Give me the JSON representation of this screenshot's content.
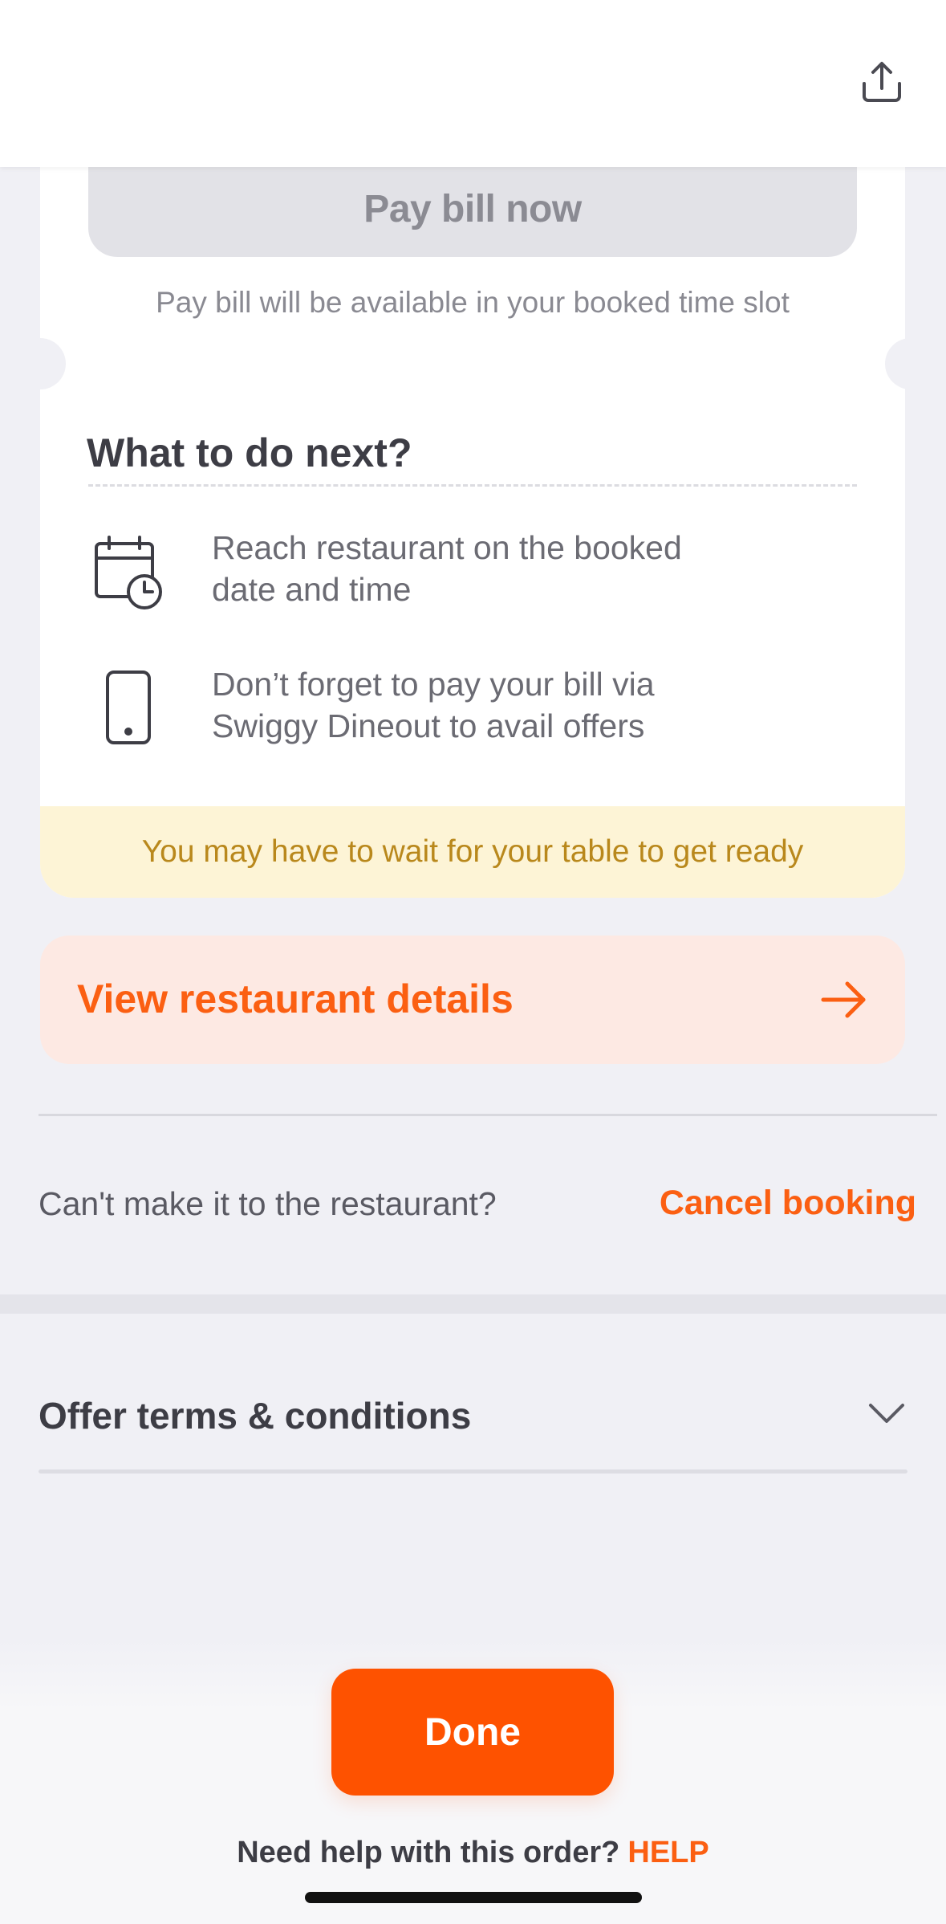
{
  "header": {
    "share_icon": "share-upload-icon"
  },
  "booking_card": {
    "pay_bill_label": "Pay bill now",
    "pay_bill_note": "Pay bill will be available in your booked time slot",
    "next_title": "What to do next?",
    "steps": [
      {
        "icon": "calendar-clock-icon",
        "text_line1": "Reach restaurant on the booked",
        "text_line2": "date and time"
      },
      {
        "icon": "phone-icon",
        "text_line1": "Don’t forget to pay your bill via",
        "text_line2": "Swiggy Dineout to avail offers"
      }
    ],
    "wait_note": "You may have to wait for your table to get ready"
  },
  "restaurant_details": {
    "label": "View restaurant details",
    "icon": "arrow-right-icon"
  },
  "cancel_section": {
    "question": "Can't make it to the restaurant?",
    "cancel_label": "Cancel booking"
  },
  "offer_terms": {
    "label": "Offer terms & conditions",
    "icon": "chevron-down-icon"
  },
  "footer": {
    "done_label": "Done",
    "help_text": "Need help with this order?",
    "help_link": "HELP"
  },
  "colors": {
    "accent": "#fe5200",
    "accent_text": "#fb5f12",
    "wait_bg": "#fdf4d6",
    "wait_text": "#b9881c",
    "details_bg": "#fde9e3"
  }
}
